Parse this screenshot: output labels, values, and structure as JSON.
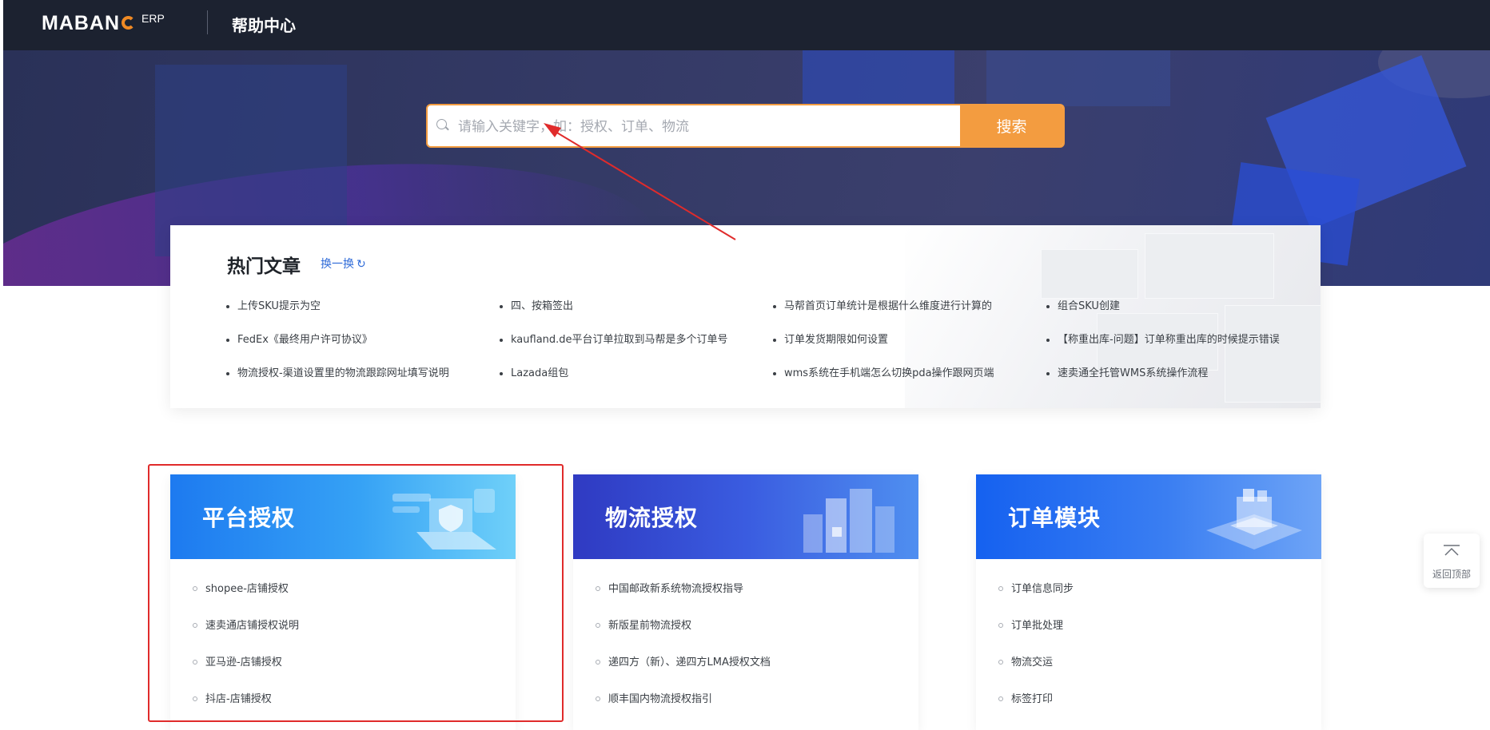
{
  "nav": {
    "logo_text": "MABAN",
    "logo_sup": "ERP",
    "title": "帮助中心"
  },
  "search": {
    "placeholder": "请输入关键字，如：授权、订单、物流",
    "button_label": "搜索"
  },
  "hot": {
    "title": "热门文章",
    "refresh_label": "换一换",
    "items": [
      "上传SKU提示为空",
      "四、按箱签出",
      "马帮首页订单统计是根据什么维度进行计算的",
      "组合SKU创建",
      "FedEx《最终用户许可协议》",
      "kaufland.de平台订单拉取到马帮是多个订单号",
      "订单发货期限如何设置",
      "【称重出库-问题】订单称重出库的时候提示错误",
      "物流授权-渠道设置里的物流跟踪网址填写说明",
      "Lazada组包",
      "wms系统在手机端怎么切换pda操作跟网页端",
      "速卖通全托管WMS系统操作流程"
    ]
  },
  "categories": [
    {
      "title": "平台授权",
      "items": [
        "shopee-店铺授权",
        "速卖通店铺授权说明",
        "亚马逊-店铺授权",
        "抖店-店铺授权"
      ]
    },
    {
      "title": "物流授权",
      "items": [
        "中国邮政新系统物流授权指导",
        "新版星前物流授权",
        "递四方（新）、递四方LMA授权文档",
        "顺丰国内物流授权指引"
      ]
    },
    {
      "title": "订单模块",
      "items": [
        "订单信息同步",
        "订单批处理",
        "物流交运",
        "标签打印"
      ]
    }
  ],
  "back_top": {
    "label": "返回顶部"
  },
  "colors": {
    "accent": "#f39c40",
    "nav_bg": "#1c2230",
    "link": "#2f6bd8",
    "annotation": "#e02b2b"
  },
  "icons": [
    "search-icon",
    "refresh-icon",
    "shield-laptop-illustration",
    "building-illustration",
    "order-box-illustration",
    "arrow-up-icon"
  ]
}
